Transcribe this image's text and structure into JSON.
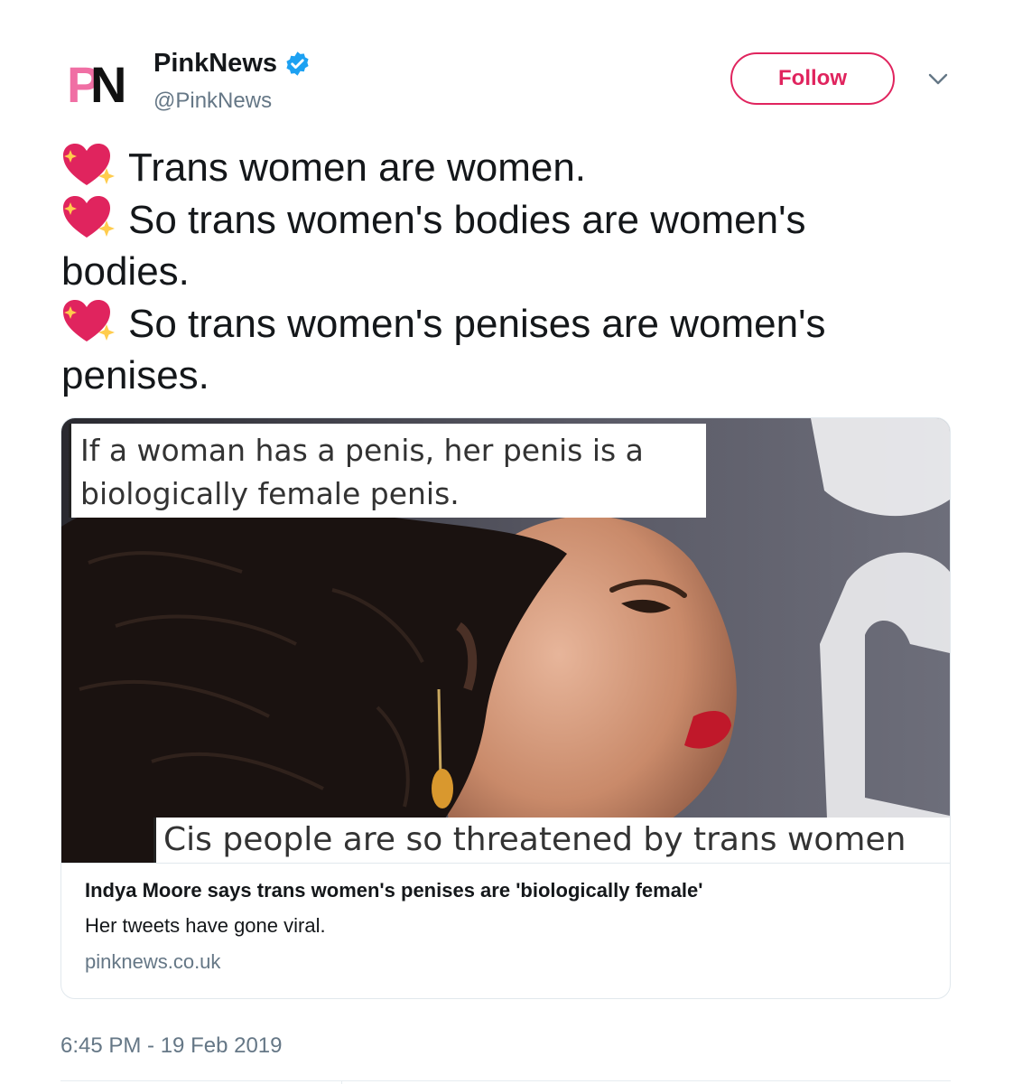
{
  "account": {
    "logo_text": "PN",
    "display_name": "PinkNews",
    "handle": "@PinkNews",
    "verified": true
  },
  "follow_button": {
    "label": "Follow"
  },
  "tweet": {
    "lines": [
      {
        "emoji": "sparkling-heart",
        "text": "Trans women are women."
      },
      {
        "emoji": "sparkling-heart",
        "text": "So trans women's bodies are women's bodies."
      },
      {
        "emoji": "sparkling-heart",
        "text": "So trans women's penises are women's penises."
      }
    ],
    "timestamp": "6:45 PM - 19 Feb 2019"
  },
  "card": {
    "image_caption_top": "If a woman has a penis, her penis is a biologically female penis.",
    "image_caption_bottom": "Cis people are so threatened by trans women",
    "title": "Indya Moore says trans women's penises are 'biologically female'",
    "description": "Her tweets have gone viral.",
    "domain": "pinknews.co.uk"
  },
  "colors": {
    "brand_pink": "#e0245e",
    "logo_pink": "#f06fa4",
    "verified_blue": "#1da1f2",
    "secondary_text": "#657786"
  }
}
